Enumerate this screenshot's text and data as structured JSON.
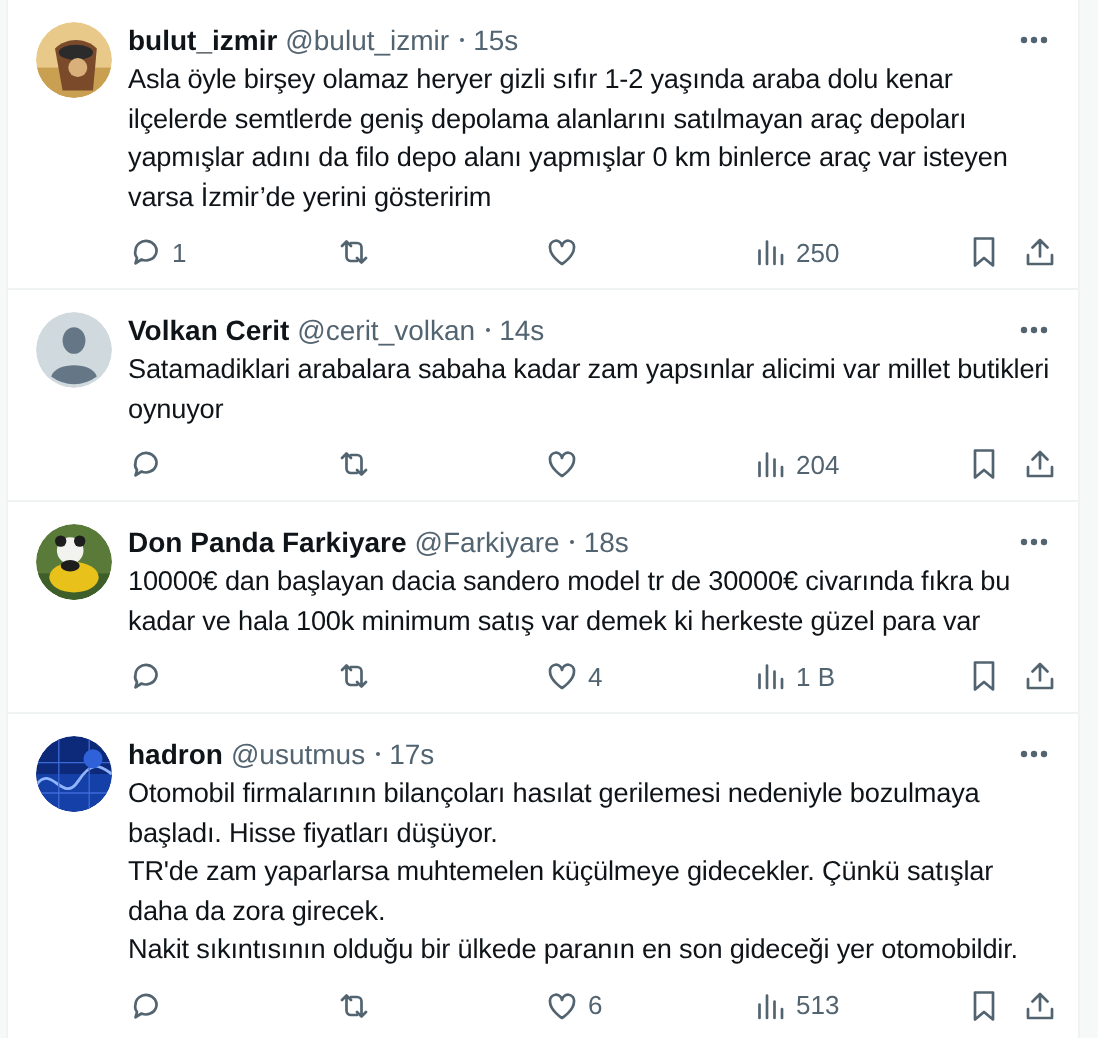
{
  "tweets": [
    {
      "name": "bulut_izmir",
      "handle": "@bulut_izmir",
      "time": "15s",
      "text": "Asla öyle birşey olamaz heryer gizli sıfır 1-2 yaşında araba dolu kenar ilçelerde semtlerde geniş depolama alanlarını satılmayan araç depoları yapmışlar adını da filo depo alanı yapmışlar 0 km binlerce araç var isteyen varsa İzmir’de yerini gösteririm",
      "replies": "1",
      "views": "250"
    },
    {
      "avatar": {
        "kind": "default"
      },
      "name": "Volkan Cerit",
      "handle": "@cerit_volkan",
      "time": "14s",
      "text": "Satamadiklari arabalara sabaha kadar zam yapsınlar alicimi var millet butikleri oynuyor",
      "views": "204"
    },
    {
      "name": "Don Panda Farkiyare",
      "handle": "@Farkiyare",
      "time": "18s",
      "text": "10000€ dan başlayan dacia sandero model tr de 30000€ civarında fıkra bu kadar ve hala 100k minimum satış var demek ki herkeste güzel para var",
      "likes": "4",
      "views": "1 B"
    },
    {
      "name": "hadron",
      "handle": "@usutmus",
      "time": "17s",
      "text": "Otomobil firmalarının bilançoları hasılat gerilemesi nedeniyle bozulmaya başladı. Hisse fiyatları düşüyor.\nTR'de zam yaparlarsa muhtemelen küçülmeye gidecekler. Çünkü satışlar daha da zora girecek.\nNakit sıkıntısının olduğu bir ülkede paranın en son gideceği yer otomobildir.",
      "likes": "6",
      "views": "513"
    }
  ]
}
